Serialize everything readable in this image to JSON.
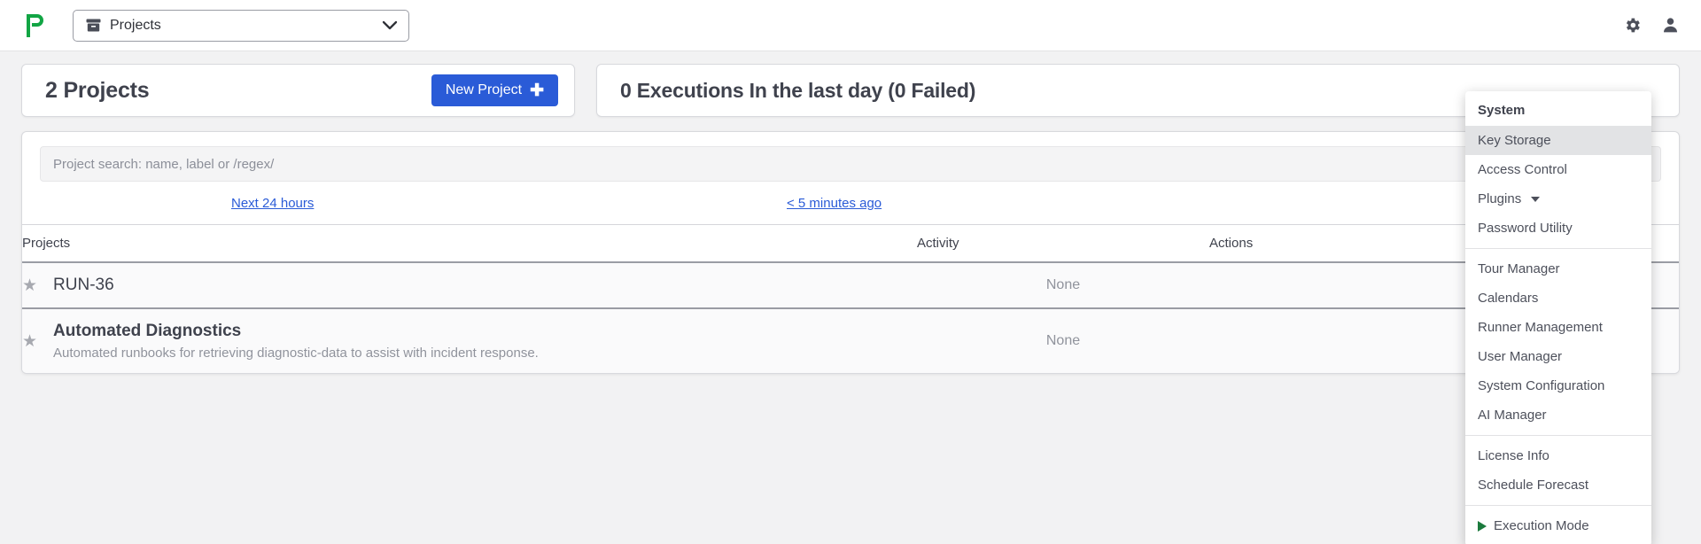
{
  "navbar": {
    "logo_icon": "rundeck-p-logo",
    "project_selector": {
      "icon": "archive-box-icon",
      "label": "Projects",
      "chevron_icon": "chevron-down-icon"
    },
    "gear_icon": "gear-icon",
    "user_icon": "user-icon"
  },
  "stats": {
    "projects_card": {
      "title": "2 Projects",
      "new_project_label": "New Project",
      "plus_icon": "plus-icon"
    },
    "executions_card": {
      "title": "0 Executions In the last day (0 Failed)"
    }
  },
  "search": {
    "placeholder": "Project search: name, label or /regex/",
    "value": "",
    "submit_icon": "search-arrow-icon"
  },
  "links": {
    "next_24_hours": "Next 24 hours",
    "recent": "< 5 minutes ago"
  },
  "table": {
    "headers": {
      "projects": "Projects",
      "activity": "Activity",
      "actions": "Actions"
    },
    "rows": [
      {
        "star_icon": "star-icon",
        "name": "RUN-36",
        "description": "",
        "activity": "None"
      },
      {
        "star_icon": "star-icon",
        "name": "Automated Diagnostics",
        "description": "Automated runbooks for retrieving diagnostic-data to assist with incident response.",
        "activity": "None"
      }
    ]
  },
  "system_menu": {
    "header": "System",
    "items": [
      {
        "label": "Key Storage",
        "state": "active",
        "icon": ""
      },
      {
        "label": "Access Control",
        "state": "normal",
        "icon": ""
      },
      {
        "label": "Plugins",
        "state": "normal",
        "icon": "caret-down-icon"
      },
      {
        "label": "Password Utility",
        "state": "normal",
        "icon": ""
      },
      {
        "label": "__separator__",
        "state": "separator",
        "icon": ""
      },
      {
        "label": "Tour Manager",
        "state": "normal",
        "icon": ""
      },
      {
        "label": "Calendars",
        "state": "normal",
        "icon": ""
      },
      {
        "label": "Runner Management",
        "state": "normal",
        "icon": ""
      },
      {
        "label": "User Manager",
        "state": "normal",
        "icon": ""
      },
      {
        "label": "System Configuration",
        "state": "normal",
        "icon": ""
      },
      {
        "label": "AI Manager",
        "state": "normal",
        "icon": ""
      },
      {
        "label": "__separator__",
        "state": "separator",
        "icon": ""
      },
      {
        "label": "License Info",
        "state": "normal",
        "icon": ""
      },
      {
        "label": "Schedule Forecast",
        "state": "normal",
        "icon": ""
      },
      {
        "label": "__separator__",
        "state": "separator",
        "icon": ""
      },
      {
        "label": "Execution Mode",
        "state": "normal",
        "icon": "play-triangle-icon"
      }
    ]
  },
  "colors": {
    "brand_green": "#12a544",
    "primary_blue": "#2a5bd7",
    "link_blue": "#2a5bd7",
    "text_dark": "#3f424d",
    "text_muted": "#90939c",
    "execution_green": "#1b7a3d"
  }
}
